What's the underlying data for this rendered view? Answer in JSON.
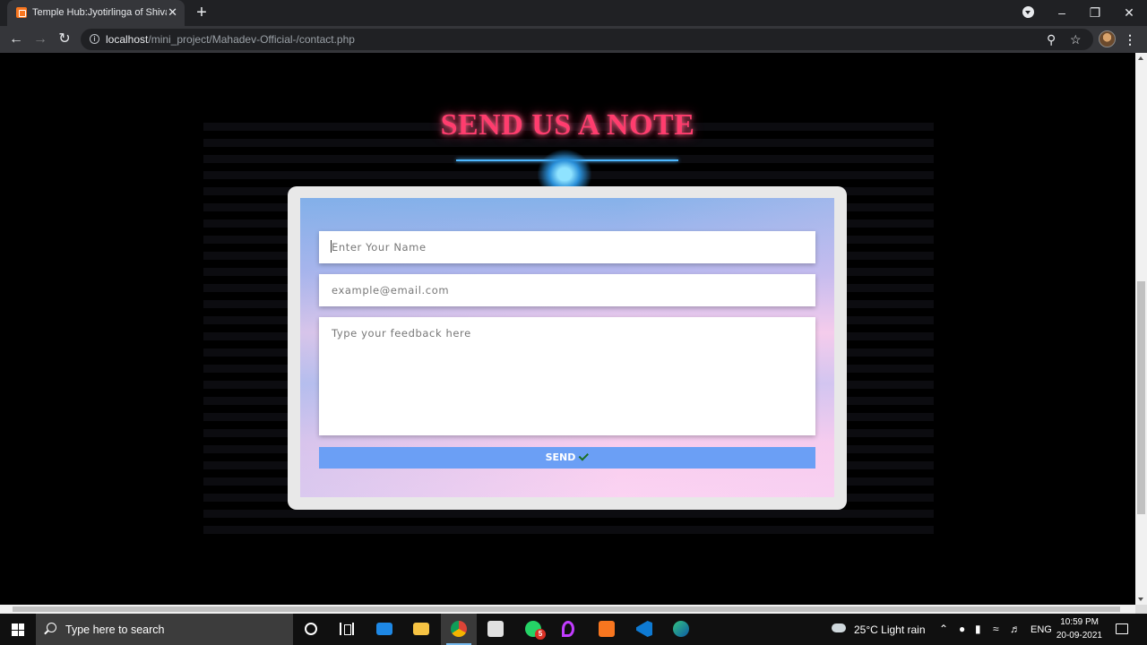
{
  "browser": {
    "tab_title": "Temple Hub:Jyotirlinga of Shiva",
    "tab_close": "✕",
    "new_tab": "+",
    "url_host": "localhost",
    "url_path": "/mini_project/Mahadev-Official-/contact.php"
  },
  "page": {
    "heading": "SEND US A NOTE",
    "form": {
      "name_placeholder": "Enter Your Name",
      "email_placeholder": "example@email.com",
      "feedback_placeholder": "Type your feedback here",
      "send_label": "SEND"
    }
  },
  "taskbar": {
    "search_placeholder": "Type here to search",
    "whatsapp_badge": "5",
    "weather": "25°C  Light rain",
    "language": "ENG",
    "time": "10:59 PM",
    "date": "20-09-2021"
  },
  "colors": {
    "heading": "#ff3d6e",
    "underline": "#4db8ff",
    "send_button": "#6b9ff5",
    "form_frame": "#e8e8e8"
  }
}
